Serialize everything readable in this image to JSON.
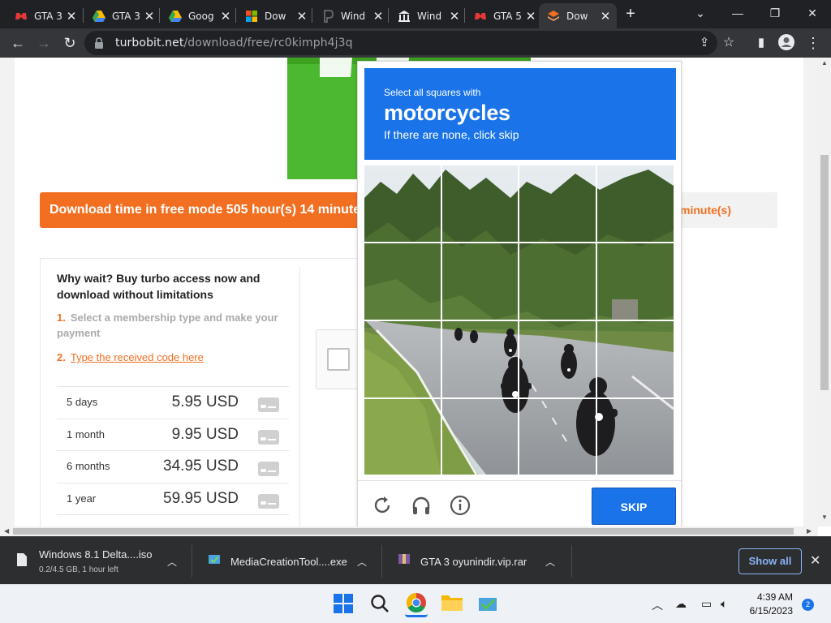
{
  "browser": {
    "tabs": [
      {
        "title": "GTA 3",
        "favicon": "gamepad-icon",
        "active": false
      },
      {
        "title": "GTA 3",
        "favicon": "google-drive-icon",
        "active": false
      },
      {
        "title": "Goog",
        "favicon": "google-drive-icon",
        "active": false
      },
      {
        "title": "Dow",
        "favicon": "microsoft-icon",
        "active": false
      },
      {
        "title": "Wind",
        "favicon": "p-logo-icon",
        "active": false
      },
      {
        "title": "Wind",
        "favicon": "archive-icon",
        "active": false
      },
      {
        "title": "GTA 5",
        "favicon": "gamepad-icon",
        "active": false
      },
      {
        "title": "Dow",
        "favicon": "layers-icon",
        "active": true
      }
    ],
    "url_host": "turbobit.net",
    "url_path": "/download/free/rc0kimph4j3q"
  },
  "page": {
    "download_notice": "Download time in free mode 505 hour(s) 14 minute",
    "download_notice_tail": "minute(s)",
    "buy_title": "Why wait? Buy turbo access now and download without limitations",
    "step1_num": "1.",
    "step1_text": "Select a membership type and make your payment",
    "step2_num": "2.",
    "step2_link": "Type the received code here",
    "prices": [
      {
        "period": "5 days",
        "amount": "5.95 USD"
      },
      {
        "period": "1 month",
        "amount": "9.95 USD"
      },
      {
        "period": "6 months",
        "amount": "34.95 USD"
      },
      {
        "period": "1 year",
        "amount": "59.95 USD"
      }
    ]
  },
  "captcha": {
    "instruction_top": "Select all squares with",
    "target": "motorcycles",
    "instruction_bottom": "If there are none, click skip",
    "skip_label": "SKIP",
    "colors": {
      "header": "#1a73e8"
    }
  },
  "downloads": {
    "items": [
      {
        "name": "Windows 8.1 Delta....iso",
        "meta": "0.2/4.5 GB, 1 hour left"
      },
      {
        "name": "MediaCreationTool....exe",
        "meta": ""
      },
      {
        "name": "GTA 3 oyunindir.vip.rar",
        "meta": ""
      }
    ],
    "show_all": "Show all"
  },
  "taskbar": {
    "time": "4:39 AM",
    "date": "6/15/2023",
    "notification_count": "2"
  }
}
